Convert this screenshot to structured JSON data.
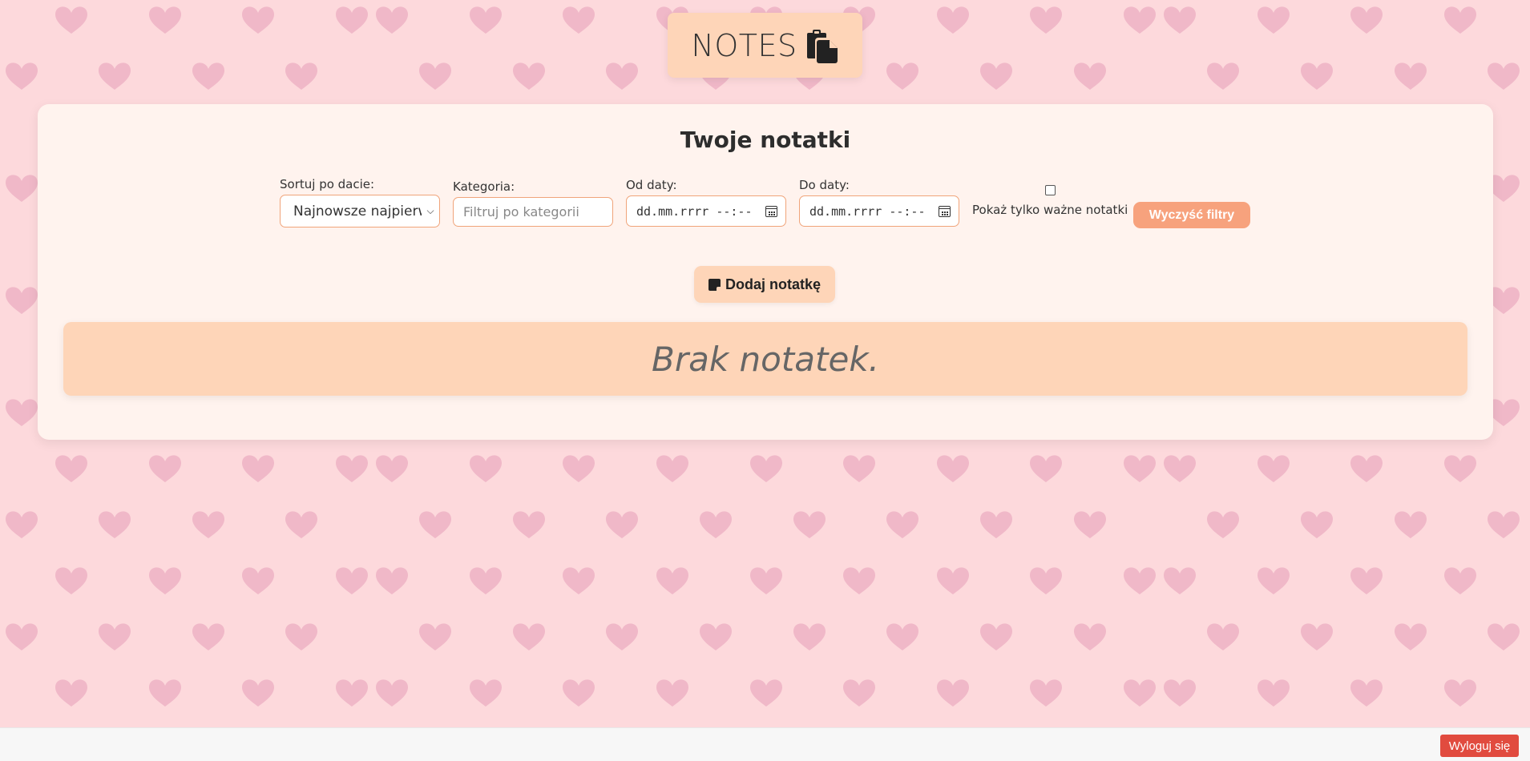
{
  "app": {
    "title": "NOTES",
    "title_icon": "clipboard-icon"
  },
  "panel": {
    "heading": "Twoje notatki"
  },
  "filters": {
    "sort_label": "Sortuj po dacie:",
    "sort_value": "Najnowsze najpierw",
    "category_label": "Kategoria:",
    "category_placeholder": "Filtruj po kategorii",
    "category_value": "",
    "date_from_label": "Od daty:",
    "date_from_value": "dd.mm.rrrr --:--",
    "date_to_label": "Do daty:",
    "date_to_value": "dd.mm.rrrr --:--",
    "important_only_label": "Pokaż tylko ważne notatki",
    "important_only_checked": false,
    "clear_label": "Wyczyść filtry"
  },
  "actions": {
    "add_note_label": "Dodaj notatkę",
    "add_note_icon": "sticky-note-icon"
  },
  "notes": {
    "empty_message": "Brak notatek."
  },
  "footer": {
    "logout_label": "Wyloguj się"
  },
  "colors": {
    "background": "#fdd9dc",
    "hearts": "#f0b8c8",
    "panel": "#fff3ee",
    "accent": "#fed5b8",
    "clear_button": "#f7a27d",
    "logout_button": "#e14b3f"
  }
}
